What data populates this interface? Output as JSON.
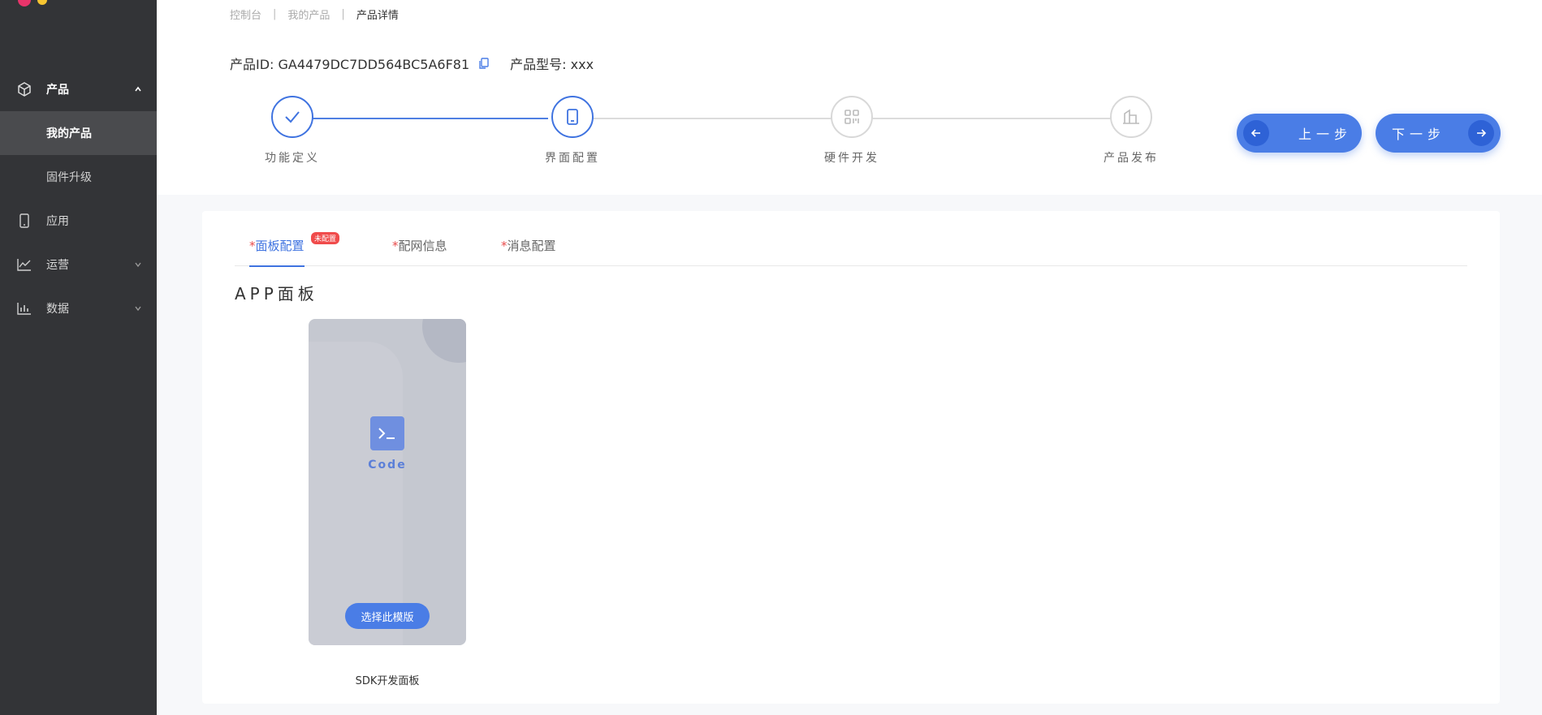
{
  "sidebar": {
    "items": [
      {
        "label": "产品",
        "icon": "box-icon",
        "expanded": true
      },
      {
        "label": "我的产品",
        "active": true
      },
      {
        "label": "固件升级"
      },
      {
        "label": "应用",
        "icon": "phone-icon"
      },
      {
        "label": "运营",
        "icon": "line-chart-icon",
        "expanded": false
      },
      {
        "label": "数据",
        "icon": "bar-chart-icon",
        "expanded": false
      }
    ]
  },
  "breadcrumb": {
    "items": [
      "控制台",
      "我的产品",
      "产品详情"
    ],
    "separator": "|"
  },
  "product": {
    "id_text": "产品ID: GA4479DC7DD564BC5A6F81",
    "model_text": "产品型号: xxx"
  },
  "steps": [
    {
      "label": "功能定义",
      "icon": "check-icon",
      "state": "done"
    },
    {
      "label": "界面配置",
      "icon": "tablet-icon",
      "state": "active"
    },
    {
      "label": "硬件开发",
      "icon": "grid-icon",
      "state": "pending"
    },
    {
      "label": "产品发布",
      "icon": "building-icon",
      "state": "pending"
    }
  ],
  "nav_buttons": {
    "prev": "上一步",
    "next": "下一步"
  },
  "tabs": [
    {
      "star": "*",
      "label": "面板配置",
      "badge": "未配置",
      "active": true
    },
    {
      "star": "*",
      "label": "配网信息"
    },
    {
      "star": "*",
      "label": "消息配置"
    }
  ],
  "section": {
    "title": "APP面板"
  },
  "template": {
    "code_label": "Code",
    "select_label": "选择此模版",
    "name": "SDK开发面板"
  },
  "colors": {
    "primary": "#4a7de6",
    "sidebar_bg": "#333437",
    "danger": "#f04b4b"
  }
}
